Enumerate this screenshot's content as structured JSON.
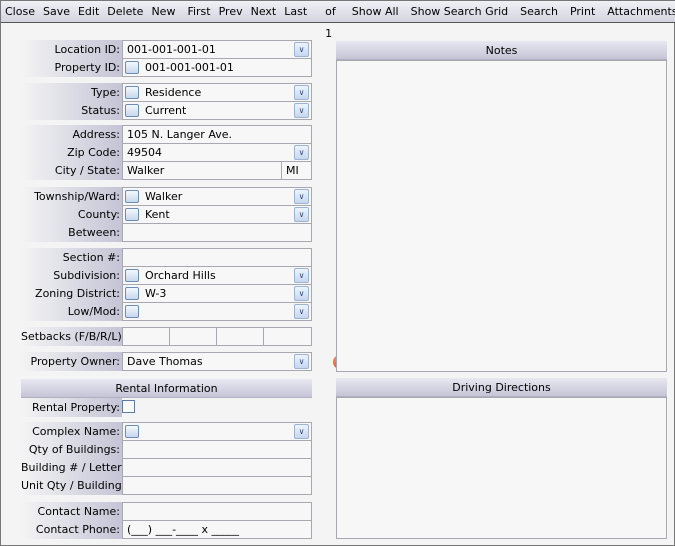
{
  "toolbar": {
    "close": "Close",
    "save": "Save",
    "edit": "Edit",
    "delete": "Delete",
    "new": "New",
    "first": "First",
    "prev": "Prev",
    "next": "Next",
    "last": "Last",
    "record_count": "1 of 1",
    "show_all": "Show All",
    "show_search_grid": "Show Search Grid",
    "search": "Search",
    "print": "Print",
    "attachments": "Attachments"
  },
  "form": {
    "location_id": {
      "label": "Location ID:",
      "value": "001-001-001-01"
    },
    "property_id": {
      "label": "Property ID:",
      "value": "001-001-001-01"
    },
    "type": {
      "label": "Type:",
      "value": "Residence"
    },
    "status": {
      "label": "Status:",
      "value": "Current"
    },
    "address": {
      "label": "Address:",
      "value": "105 N. Langer Ave."
    },
    "zip": {
      "label": "Zip Code:",
      "value": "49504"
    },
    "city_state": {
      "label": "City / State:",
      "city": "Walker",
      "state": "MI"
    },
    "township": {
      "label": "Township/Ward:",
      "value": "Walker"
    },
    "county": {
      "label": "County:",
      "value": "Kent"
    },
    "between": {
      "label": "Between:",
      "value": ""
    },
    "section": {
      "label": "Section #:",
      "value": ""
    },
    "subdivision": {
      "label": "Subdivision:",
      "value": "Orchard Hills"
    },
    "zoning": {
      "label": "Zoning District:",
      "value": "W-3"
    },
    "lowmod": {
      "label": "Low/Mod:",
      "value": ""
    },
    "setbacks": {
      "label": "Setbacks (F/B/R/L):"
    },
    "owner": {
      "label": "Property Owner:",
      "value": "Dave Thomas"
    }
  },
  "rental": {
    "header": "Rental Information",
    "rental_property": {
      "label": "Rental Property:",
      "checked": false
    },
    "complex": {
      "label": "Complex Name:",
      "value": ""
    },
    "qty_buildings": {
      "label": "Qty of Buildings:",
      "value": ""
    },
    "building_letter": {
      "label": "Building # / Letter:",
      "value": ""
    },
    "unit_qty": {
      "label": "Unit Qty / Building:",
      "value": ""
    },
    "contact_name": {
      "label": "Contact Name:",
      "value": ""
    },
    "contact_phone": {
      "label": "Contact Phone:",
      "value": "(___) ___-____ x _____"
    }
  },
  "notes": {
    "header": "Notes"
  },
  "directions": {
    "header": "Driving Directions"
  },
  "colors": {
    "alert": "#d83a10",
    "label_gradient_end": "#c4c4d6"
  }
}
